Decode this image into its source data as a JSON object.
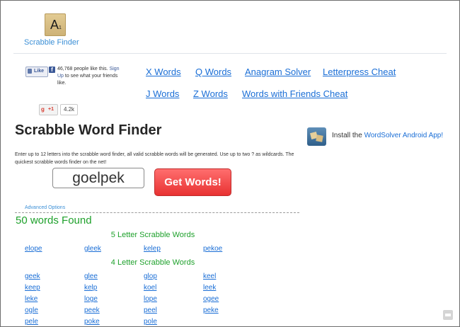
{
  "logo": {
    "tile_letter": "A",
    "tile_points": "1",
    "name": "Scrabble Finder"
  },
  "facebook": {
    "like_label": "Like",
    "f_glyph": "f",
    "count_text": "46,768 people like this.",
    "signup_link": "Sign Up",
    "signup_rest": " to see what your friends like."
  },
  "nav": {
    "row1": [
      "X Words",
      "Q Words",
      "Anagram Solver",
      "Letterpress Cheat"
    ],
    "row2": [
      "J Words",
      "Z Words",
      "Words with Friends Cheat"
    ]
  },
  "gplus": {
    "label": "+1",
    "g": "g",
    "count": "4.2k"
  },
  "title": "Scrabble Word Finder",
  "install": {
    "prefix": "Install the ",
    "link": "WordSolver Android App!"
  },
  "description": "Enter up to 12 letters into the scrabble word finder, all valid scrabble words will be generated. Use up to two ? as wildcards. The quickest scrabble words finder on the net!",
  "search": {
    "value": "goelpek",
    "button": "Get Words!"
  },
  "advanced_options": "Advanced Options",
  "results": {
    "found": "50 words Found",
    "sections": [
      {
        "heading": "5 Letter Scrabble Words",
        "words": [
          "elope",
          "gleek",
          "kelep",
          "pekoe"
        ]
      },
      {
        "heading": "4 Letter Scrabble Words",
        "words": [
          "geek",
          "glee",
          "glop",
          "keel",
          "keep",
          "kelp",
          "koel",
          "leek",
          "leke",
          "loge",
          "lope",
          "ogee",
          "ogle",
          "peek",
          "peel",
          "peke",
          "pele",
          "poke",
          "pole"
        ]
      }
    ]
  }
}
